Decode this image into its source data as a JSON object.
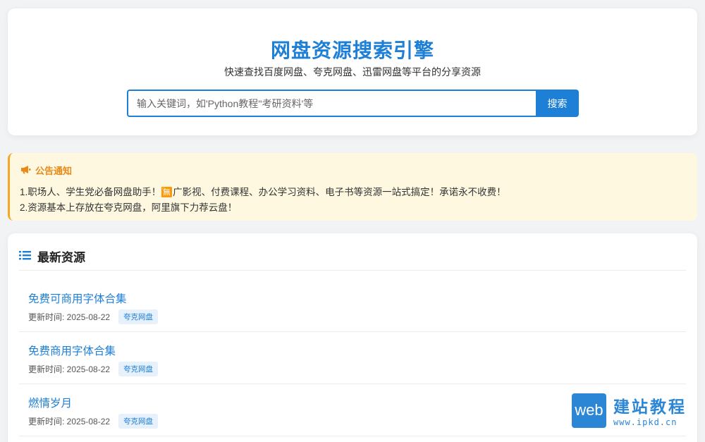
{
  "hero": {
    "title": "网盘资源搜索引擎",
    "subtitle": "快速查找百度网盘、夸克网盘、迅雷网盘等平台的分享资源",
    "search_placeholder": "输入关键词，如'Python教程''考研资料'等",
    "search_value": "",
    "search_button": "搜索"
  },
  "notice": {
    "icon": "megaphone-icon",
    "title": "公告通知",
    "lines": [
      "1.职场人、学生党必备网盘助手！🈚广影视、付费课程、办公学习资料、电子书等资源一站式搞定！承诺永不收费！",
      "2.资源基本上存放在夸克网盘，阿里旗下力荐云盘！"
    ]
  },
  "resources": {
    "icon": "list-icon",
    "title": "最新资源",
    "items": [
      {
        "title": "免费可商用字体合集",
        "updated": "更新时间: 2025-08-22",
        "tag": "夸克网盘"
      },
      {
        "title": "免费商用字体合集",
        "updated": "更新时间: 2025-08-22",
        "tag": "夸克网盘"
      },
      {
        "title": "燃情岁月",
        "updated": "更新时间: 2025-08-22",
        "tag": "夸克网盘"
      }
    ]
  },
  "watermark": {
    "logo_text": "web",
    "cn": "建站教程",
    "url": "www.ipkd.cn"
  },
  "colors": {
    "accent": "#1e7fd6",
    "notice_bg": "#fff8e1",
    "notice_accent": "#f5a623",
    "background": "#f2f3f5"
  }
}
